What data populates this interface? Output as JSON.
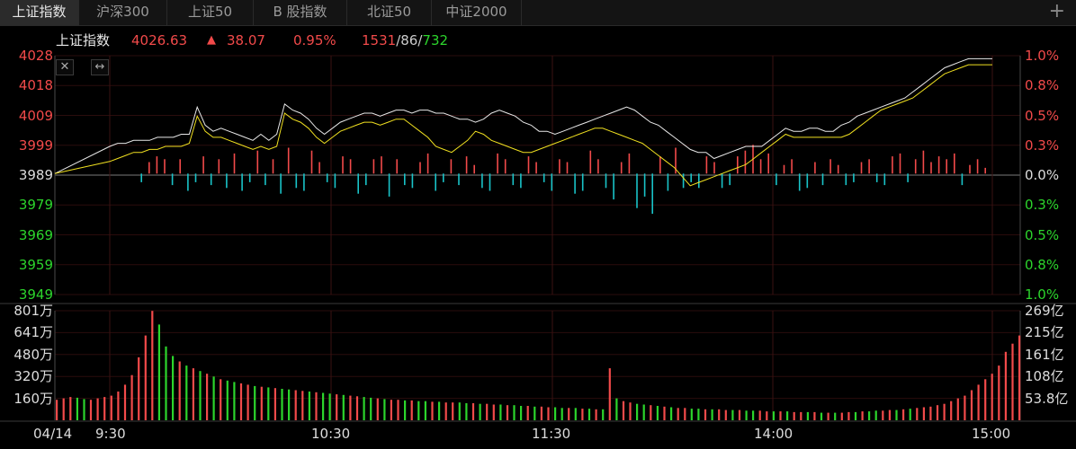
{
  "tabs": [
    {
      "label": "上证指数",
      "active": true
    },
    {
      "label": "沪深300",
      "active": false
    },
    {
      "label": "上证50",
      "active": false
    },
    {
      "label": "B 股指数",
      "active": false
    },
    {
      "label": "北证50",
      "active": false
    },
    {
      "label": "中证2000",
      "active": false
    }
  ],
  "add_tab_icon": "plus-icon",
  "info": {
    "name": "上证指数",
    "price": "4026.63",
    "arrow": "▲",
    "change": "38.07",
    "pct": "0.95%",
    "up": "1531",
    "flat": "86",
    "down": "732",
    "sep1": "/",
    "sep2": "/"
  },
  "buttons": {
    "close_icon": "close-icon",
    "expand_icon": "resize-horizontal-icon",
    "close_glyph": "✕",
    "expand_glyph": "↔"
  },
  "colors": {
    "up": "#f24a4a",
    "down": "#2cd52c",
    "price_line": "#e8e8e8",
    "avg_line": "#f0e020",
    "bar_down": "#19c3c8",
    "grid": "#3a1010",
    "axis": "#6a6a6a"
  },
  "chart_data": [
    {
      "type": "line",
      "title": "",
      "x_ticks": [
        "04/14",
        "9:30",
        "10:30",
        "11:30",
        "14:00",
        "15:00"
      ],
      "y_ticks_left": [
        "4028",
        "4018",
        "4009",
        "3999",
        "3989",
        "3979",
        "3969",
        "3959",
        "3949"
      ],
      "y_ticks_right": [
        "1.0%",
        "0.8%",
        "0.5%",
        "0.3%",
        "0.0%",
        "0.3%",
        "0.5%",
        "0.8%",
        "1.0%"
      ],
      "ylim": [
        3949,
        4028
      ],
      "prev_close": 3989,
      "series": [
        {
          "values": [
            3989,
            3998,
            3999,
            3999,
            4000,
            4000,
            4000,
            4001,
            4001,
            4001,
            4002,
            4002,
            4011,
            4005,
            4003,
            4004,
            4003,
            4002,
            4001,
            4000,
            4002,
            4000,
            4002,
            4012,
            4010,
            4009,
            4007,
            4004,
            4002,
            4004,
            4006,
            4007,
            4008,
            4009,
            4009,
            4008,
            4009,
            4010,
            4010,
            4009,
            4010,
            4010,
            4009,
            4009,
            4008,
            4007,
            4007,
            4006,
            4007,
            4009,
            4010,
            4009,
            4008,
            4006,
            4005,
            4003,
            4003,
            4002,
            4003,
            4004,
            4005,
            4006,
            4007,
            4008,
            4009,
            4010,
            4011,
            4010,
            4008,
            4006,
            4005,
            4003,
            4001,
            3999,
            3997,
            3996,
            3996,
            3994,
            3995,
            3996,
            3997,
            3998,
            3998,
            3998,
            4000,
            4002,
            4004,
            4003,
            4003,
            4004,
            4004,
            4003,
            4003,
            4005,
            4006,
            4008,
            4009,
            4010,
            4011,
            4012,
            4013,
            4014,
            4016,
            4018,
            4020,
            4022,
            4024,
            4025,
            4026,
            4027,
            4027,
            4027,
            4027
          ]
        },
        {
          "values": [
            3989,
            3993,
            3994,
            3995,
            3996,
            3996,
            3997,
            3997,
            3998,
            3998,
            3998,
            3999,
            4008,
            4003,
            4001,
            4001,
            4000,
            3999,
            3998,
            3997,
            3998,
            3997,
            3998,
            4009,
            4007,
            4006,
            4004,
            4001,
            3999,
            4001,
            4003,
            4004,
            4005,
            4006,
            4006,
            4005,
            4006,
            4007,
            4007,
            4005,
            4003,
            4001,
            3998,
            3997,
            3996,
            3998,
            4000,
            4003,
            4002,
            4000,
            3999,
            3998,
            3997,
            3996,
            3996,
            3997,
            3998,
            3999,
            4000,
            4001,
            4002,
            4003,
            4004,
            4004,
            4003,
            4002,
            4001,
            4000,
            3999,
            3997,
            3995,
            3993,
            3991,
            3988,
            3985,
            3986,
            3987,
            3988,
            3989,
            3990,
            3991,
            3992,
            3994,
            3996,
            3998,
            4000,
            4002,
            4001,
            4001,
            4001,
            4001,
            4001,
            4001,
            4001,
            4002,
            4004,
            4006,
            4008,
            4010,
            4011,
            4012,
            4013,
            4014,
            4016,
            4018,
            4020,
            4022,
            4023,
            4024,
            4025,
            4025,
            4025,
            4025
          ]
        }
      ],
      "adv_dec": [
        0,
        0,
        0,
        0,
        -3,
        4,
        6,
        5,
        -4,
        5,
        -6,
        -3,
        6,
        -4,
        5,
        -5,
        7,
        -6,
        -3,
        8,
        -4,
        5,
        -7,
        9,
        -5,
        -6,
        8,
        4,
        -3,
        -5,
        6,
        5,
        -7,
        -4,
        5,
        6,
        -8,
        5,
        -4,
        -5,
        4,
        7,
        -6,
        -3,
        5,
        -4,
        6,
        3,
        -5,
        -6,
        7,
        5,
        -4,
        -5,
        6,
        4,
        -3,
        -6,
        5,
        4,
        -7,
        -6,
        8,
        5,
        -5,
        -9,
        4,
        7,
        -12,
        -8,
        -14,
        6,
        -6,
        9,
        -5,
        -3,
        -5,
        6,
        4,
        -5,
        -4,
        6,
        8,
        10,
        5,
        7,
        -4,
        3,
        5,
        -6,
        -5,
        4,
        -4,
        5,
        3,
        -4,
        -3,
        4,
        5,
        -3,
        -4,
        6,
        7,
        -3,
        5,
        8,
        4,
        6,
        5,
        7,
        -4,
        3,
        5,
        2,
        0
      ]
    },
    {
      "type": "bar",
      "title": "",
      "y_ticks_left": [
        "801万",
        "641万",
        "480万",
        "320万",
        "160万"
      ],
      "y_ticks_right": [
        "269亿",
        "215亿",
        "161亿",
        "108亿",
        "53.8亿"
      ],
      "ylim": [
        0,
        801
      ],
      "values": [
        150,
        160,
        170,
        165,
        155,
        150,
        160,
        170,
        180,
        210,
        260,
        330,
        460,
        620,
        800,
        700,
        540,
        470,
        430,
        400,
        380,
        360,
        340,
        320,
        300,
        290,
        280,
        270,
        260,
        250,
        245,
        240,
        235,
        230,
        225,
        220,
        215,
        210,
        205,
        200,
        195,
        190,
        185,
        180,
        175,
        170,
        165,
        160,
        155,
        150,
        150,
        145,
        145,
        140,
        140,
        135,
        135,
        130,
        130,
        130,
        125,
        125,
        120,
        120,
        115,
        115,
        110,
        110,
        105,
        105,
        100,
        100,
        95,
        95,
        90,
        90,
        90,
        85,
        85,
        80,
        80,
        380,
        160,
        140,
        130,
        120,
        115,
        110,
        105,
        100,
        95,
        90,
        90,
        85,
        85,
        80,
        80,
        80,
        75,
        75,
        75,
        70,
        70,
        70,
        65,
        65,
        65,
        65,
        60,
        60,
        60,
        60,
        55,
        55,
        55,
        55,
        60,
        60,
        65,
        65,
        70,
        70,
        75,
        75,
        80,
        85,
        90,
        95,
        100,
        110,
        120,
        140,
        160,
        180,
        220,
        260,
        300,
        340,
        400,
        500,
        560,
        620
      ],
      "up": [
        1,
        1,
        1,
        0,
        0,
        1,
        1,
        1,
        1,
        1,
        1,
        1,
        1,
        1,
        1,
        0,
        0,
        0,
        1,
        0,
        1,
        0,
        1,
        0,
        1,
        0,
        0,
        1,
        1,
        0,
        1,
        0,
        1,
        0,
        0,
        1,
        1,
        0,
        1,
        0,
        0,
        1,
        0,
        1,
        1,
        0,
        0,
        1,
        0,
        1,
        1,
        0,
        1,
        0,
        0,
        1,
        0,
        1,
        1,
        0,
        0,
        1,
        0,
        1,
        1,
        0,
        1,
        0,
        0,
        1,
        0,
        1,
        1,
        0,
        0,
        1,
        0,
        1,
        0,
        1,
        0,
        1,
        0,
        1,
        1,
        0,
        0,
        1,
        0,
        1,
        0,
        1,
        1,
        0,
        0,
        1,
        0,
        1,
        1,
        0,
        1,
        0,
        0,
        1,
        1,
        0,
        1,
        0,
        1,
        1,
        0,
        1,
        0,
        1,
        0,
        1,
        1,
        0,
        1,
        0,
        0,
        1,
        1,
        0,
        1,
        0,
        1,
        1,
        1,
        1,
        1,
        1,
        1,
        1,
        1,
        1,
        1,
        1,
        1,
        1,
        1,
        1
      ]
    }
  ]
}
